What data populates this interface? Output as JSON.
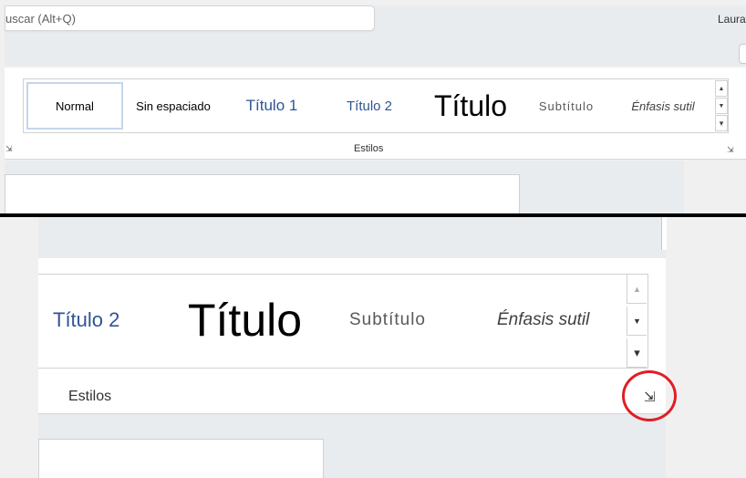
{
  "search": {
    "placeholder_text": "uscar (Alt+Q)"
  },
  "user": {
    "name": "Laura"
  },
  "styles_gallery": {
    "group_label": "Estilos",
    "items": [
      {
        "label": "Normal",
        "color": "#000000"
      },
      {
        "label": "Sin espaciado",
        "color": "#000000"
      },
      {
        "label": "Título 1",
        "color": "#2f5496"
      },
      {
        "label": "Título 2",
        "color": "#2f5496"
      },
      {
        "label": "Título",
        "color": "#000000"
      },
      {
        "label": "Subtítulo",
        "color": "#595959"
      },
      {
        "label": "Énfasis sutil",
        "color": "#404040"
      }
    ],
    "scroll_up_icon": "▲",
    "scroll_down_icon": "▼",
    "more_icon": "▾",
    "launcher_icon": "⇲"
  },
  "zoomed_view": {
    "group_label": "Estilos",
    "items": [
      {
        "label": "Título 2"
      },
      {
        "label": "Título"
      },
      {
        "label": "Subtítulo"
      },
      {
        "label": "Énfasis sutil"
      }
    ]
  },
  "colors": {
    "highlight_circle": "#e01e24",
    "selected_style_border": "#c5d6ec"
  }
}
